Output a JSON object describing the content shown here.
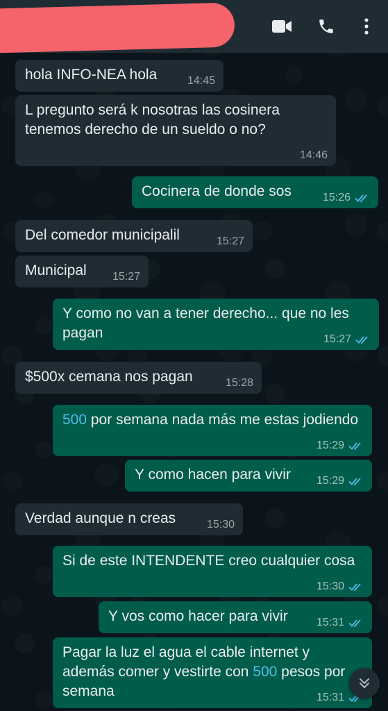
{
  "header": {
    "icons": [
      "video-call-icon",
      "phone-call-icon",
      "more-options-icon"
    ]
  },
  "colors": {
    "header_bg": "#1f2c33",
    "incoming_bubble": "#1f2c33",
    "outgoing_bubble": "#005c4b",
    "read_ticks": "#53bdeb",
    "redaction": "#f5636b"
  },
  "messages": [
    {
      "dir": "in",
      "text": "hola INFO-NEA hola",
      "time": "14:45"
    },
    {
      "dir": "in",
      "text": "L pregunto será k nosotras las cosinera tenemos derecho de un sueldo o no?",
      "time": "14:46"
    },
    {
      "dir": "out",
      "text": "Cocinera de donde sos",
      "time": "15:26"
    },
    {
      "dir": "in",
      "text": "Del comedor municipalil",
      "time": "15:27"
    },
    {
      "dir": "in",
      "text": "Municipal",
      "time": "15:27"
    },
    {
      "dir": "out",
      "text": "Y como no van a tener derecho... que no les pagan",
      "time": "15:27"
    },
    {
      "dir": "in",
      "text": "$500x cemana nos pagan",
      "time": "15:28"
    },
    {
      "dir": "out",
      "text_parts": [
        "500",
        " por semana nada más me estas jodiendo"
      ],
      "time": "15:29"
    },
    {
      "dir": "out",
      "text": "Y como hacen para vivir",
      "time": "15:29"
    },
    {
      "dir": "in",
      "text": "Verdad aunque n creas",
      "time": "15:30"
    },
    {
      "dir": "out",
      "text": "Si de este INTENDENTE creo cualquier cosa",
      "time": "15:30"
    },
    {
      "dir": "out",
      "text": "Y vos como hacer para vivir",
      "time": "15:31"
    },
    {
      "dir": "out",
      "text_parts": [
        "Pagar la luz el agua el cable internet y además comer y vestirte con ",
        "500",
        " pesos por semana"
      ],
      "time": "15:31"
    }
  ],
  "scroll_button": {
    "icon": "chevrons-down-icon"
  }
}
